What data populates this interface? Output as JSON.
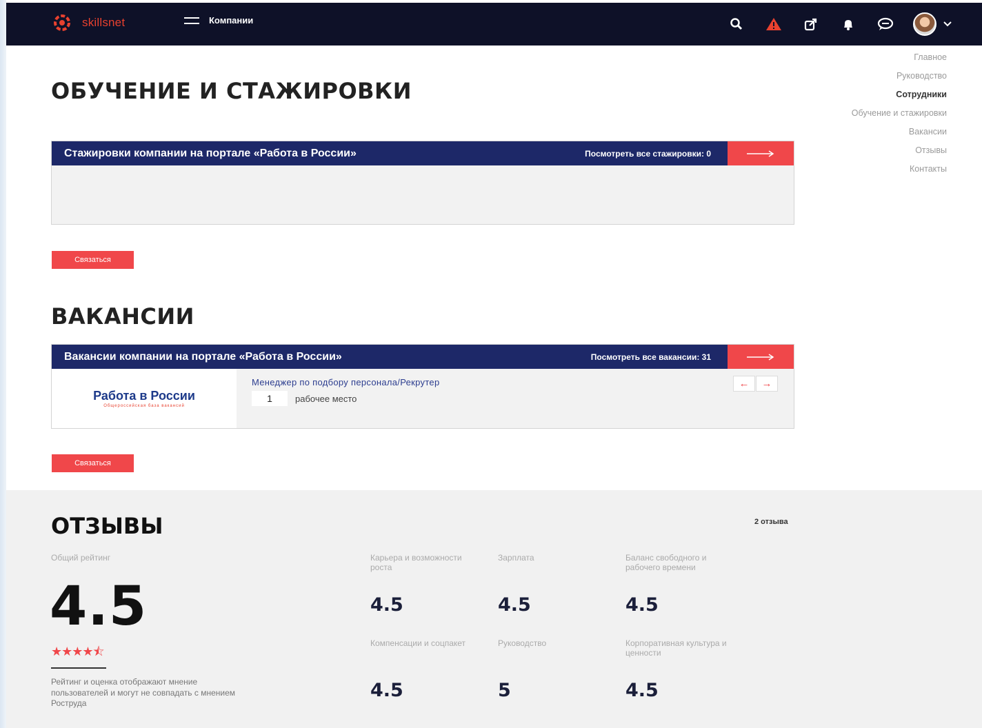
{
  "header": {
    "logo_text": "skillsnet",
    "menu_label": "Компании"
  },
  "anchor_nav": {
    "items": [
      "Главное",
      "Руководство",
      "Сотрудники",
      "Обучение и стажировки",
      "Вакансии",
      "Отзывы",
      "Контакты"
    ],
    "active": "Сотрудники"
  },
  "internships": {
    "title": "ОБУЧЕНИЕ И СТАЖИРОВКИ",
    "panel_title": "Стажировки компании на портале «Работа в России»",
    "view_all": "Посмотреть все стажировки: 0",
    "contact_button": "Связаться"
  },
  "vacancies": {
    "title": "ВАКАНСИИ",
    "panel_title": "Вакансии компании на портале «Работа в России»",
    "view_all": "Посмотреть все вакансии: 31",
    "portal_name": "Работа в России",
    "portal_sub": "Общероссийская база вакансий",
    "vacancy_title": "Менеджер по подбору персонала/Рекрутер",
    "vacancy_count": "1",
    "vacancy_count_label": "рабочее место",
    "contact_button": "Связаться"
  },
  "reviews": {
    "title": "ОТЗЫВЫ",
    "count": "2 отзыва",
    "overall_label": "Общий рейтинг",
    "overall_value": "4.5",
    "stars": "★★★★⯪",
    "note": "Рейтинг и оценка отображают мнение пользователей и могут не совпадать с мнением Роструда",
    "categories": [
      {
        "label": "Карьера и возможности роста",
        "value": "4.5"
      },
      {
        "label": "Зарплата",
        "value": "4.5"
      },
      {
        "label": "Баланс свободного и рабочего времени",
        "value": "4.5"
      },
      {
        "label": "Компенсации и соцпакет",
        "value": "4.5"
      },
      {
        "label": "Руководство",
        "value": "5"
      },
      {
        "label": "Корпоративная культура и ценности",
        "value": "4.5"
      }
    ]
  },
  "colors": {
    "nav_bg": "#0e1128",
    "panel_head": "#1d2868",
    "accent_red": "#f0474a"
  }
}
